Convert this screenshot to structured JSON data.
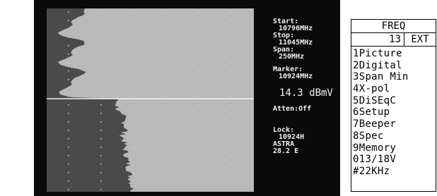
{
  "readout": {
    "start_label": "Start:",
    "start_value": "10796MHz",
    "stop_label": "Stop:",
    "stop_value": "11045MHz",
    "span_label": "Span:",
    "span_value": "250MHz",
    "marker_label": "Marker:",
    "marker_value": "10924MHz",
    "level": "14.3 dBmV",
    "atten": "Atten:Off",
    "lock_label": "Lock:",
    "lock_value": "10924H",
    "satellite": "ASTRA",
    "position": "28.2 E"
  },
  "menu": {
    "title": "FREQ",
    "number": "13",
    "mode": "EXT",
    "items": [
      "1Picture",
      "2Digital",
      "3Span Min",
      "4X-pol",
      "5DiSEqC",
      "6Setup",
      "7Beeper",
      "8Spec",
      "9Memory",
      "013/18V",
      "#22KHz"
    ]
  },
  "colors": {
    "screen_bg": "#0a0a0a",
    "spectrum_fill": "#b9b9b9",
    "noise_fill": "#4a4a4a",
    "grid_dots": "#d0d0d0",
    "marker_line": "#f5f5f5",
    "text": "#f2f2f2"
  }
}
